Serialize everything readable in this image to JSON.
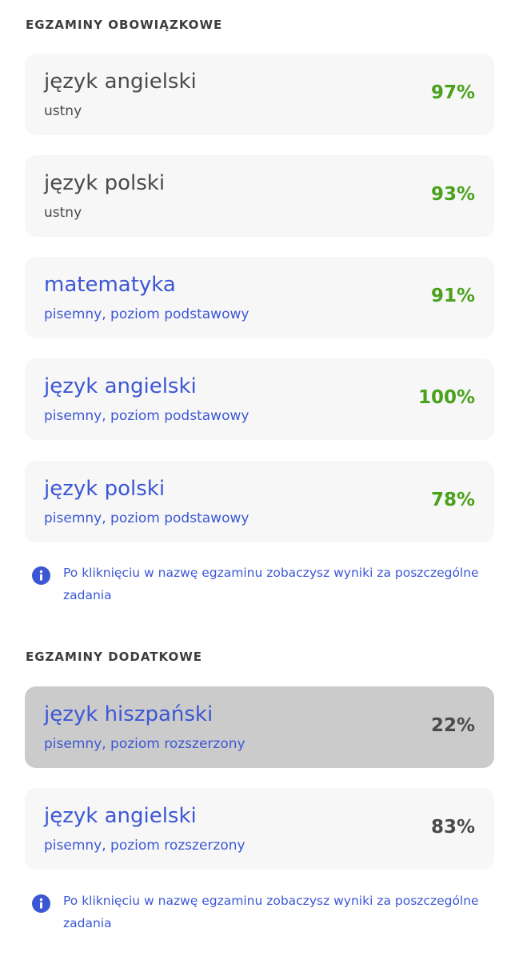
{
  "colors": {
    "gray_text": "#4a4a4a",
    "link_blue": "#3c57d4",
    "score_green": "#4aa11c",
    "score_gray": "#4a4a4a",
    "card_bg": "#f7f7f7",
    "card_selected_bg": "#cbcbcb"
  },
  "mandatory": {
    "title": "EGZAMINY OBOWIĄZKOWE",
    "exams": [
      {
        "name": "język angielski",
        "desc": "ustny",
        "score": "97%",
        "link": false
      },
      {
        "name": "język polski",
        "desc": "ustny",
        "score": "93%",
        "link": false
      },
      {
        "name": "matematyka",
        "desc": "pisemny, poziom podstawowy",
        "score": "91%",
        "link": true
      },
      {
        "name": "język angielski",
        "desc": "pisemny, poziom podstawowy",
        "score": "100%",
        "link": true
      },
      {
        "name": "język polski",
        "desc": "pisemny, poziom podstawowy",
        "score": "78%",
        "link": true
      }
    ],
    "info": "Po kliknięciu w nazwę egzaminu zobaczysz wyniki za poszczególne zadania",
    "info_icon": "info-icon"
  },
  "additional": {
    "title": "EGZAMINY DODATKOWE",
    "exams": [
      {
        "name": "język hiszpański",
        "desc": "pisemny, poziom rozszerzony",
        "score": "22%",
        "link": true,
        "selected": true
      },
      {
        "name": "język angielski",
        "desc": "pisemny, poziom rozszerzony",
        "score": "83%",
        "link": true,
        "selected": false
      }
    ],
    "info": "Po kliknięciu w nazwę egzaminu zobaczysz wyniki za poszczególne zadania",
    "info_icon": "info-icon"
  }
}
